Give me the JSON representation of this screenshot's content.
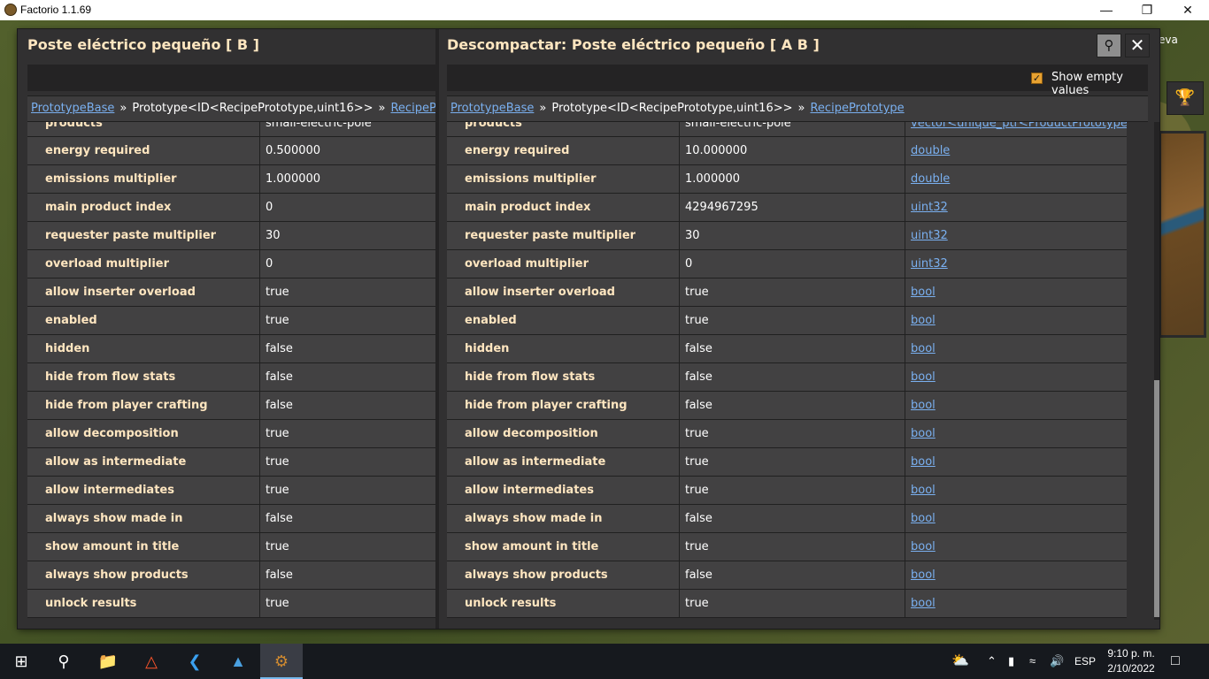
{
  "app": {
    "title": "Factorio 1.1.69"
  },
  "side": {
    "label": "eva"
  },
  "left": {
    "title": "Poste eléctrico pequeño [ B ]",
    "breadcrumb": [
      "PrototypeBase",
      "Prototype<ID<RecipePrototype,uint16>>",
      "RecipePrototype"
    ],
    "partial_value": "small-electric-pole",
    "rows": [
      {
        "name": "energy required",
        "value": "0.500000"
      },
      {
        "name": "emissions multiplier",
        "value": "1.000000"
      },
      {
        "name": "main product index",
        "value": "0"
      },
      {
        "name": "requester paste multiplier",
        "value": "30"
      },
      {
        "name": "overload multiplier",
        "value": "0"
      },
      {
        "name": "allow inserter overload",
        "value": "true"
      },
      {
        "name": "enabled",
        "value": "true"
      },
      {
        "name": "hidden",
        "value": "false"
      },
      {
        "name": "hide from flow stats",
        "value": "false"
      },
      {
        "name": "hide from player crafting",
        "value": "false"
      },
      {
        "name": "allow decomposition",
        "value": "true"
      },
      {
        "name": "allow as intermediate",
        "value": "true"
      },
      {
        "name": "allow intermediates",
        "value": "true"
      },
      {
        "name": "always show made in",
        "value": "false"
      },
      {
        "name": "show amount in title",
        "value": "true"
      },
      {
        "name": "always show products",
        "value": "false"
      },
      {
        "name": "unlock results",
        "value": "true"
      }
    ]
  },
  "right": {
    "title": "Descompactar: Poste eléctrico pequeño [ A B ]",
    "show_empty_values_label": "Show empty values",
    "show_empty_values_checked": true,
    "breadcrumb": [
      "PrototypeBase",
      "Prototype<ID<RecipePrototype,uint16>>",
      "RecipePrototype"
    ],
    "partial_value": "small-electric-pole",
    "partial_type": "vector<unique_ptr<ProductPrototype>>",
    "rows": [
      {
        "name": "energy required",
        "value": "10.000000",
        "type": "double"
      },
      {
        "name": "emissions multiplier",
        "value": "1.000000",
        "type": "double"
      },
      {
        "name": "main product index",
        "value": "4294967295",
        "type": "uint32"
      },
      {
        "name": "requester paste multiplier",
        "value": "30",
        "type": "uint32"
      },
      {
        "name": "overload multiplier",
        "value": "0",
        "type": "uint32"
      },
      {
        "name": "allow inserter overload",
        "value": "true",
        "type": "bool"
      },
      {
        "name": "enabled",
        "value": "true",
        "type": "bool"
      },
      {
        "name": "hidden",
        "value": "false",
        "type": "bool"
      },
      {
        "name": "hide from flow stats",
        "value": "false",
        "type": "bool"
      },
      {
        "name": "hide from player crafting",
        "value": "false",
        "type": "bool"
      },
      {
        "name": "allow decomposition",
        "value": "true",
        "type": "bool"
      },
      {
        "name": "allow as intermediate",
        "value": "true",
        "type": "bool"
      },
      {
        "name": "allow intermediates",
        "value": "true",
        "type": "bool"
      },
      {
        "name": "always show made in",
        "value": "false",
        "type": "bool"
      },
      {
        "name": "show amount in title",
        "value": "true",
        "type": "bool"
      },
      {
        "name": "always show products",
        "value": "false",
        "type": "bool"
      },
      {
        "name": "unlock results",
        "value": "true",
        "type": "bool"
      }
    ]
  },
  "taskbar": {
    "language": "ESP",
    "time": "9:10 p. m.",
    "date": "2/10/2022"
  },
  "colors": {
    "title_text": "#ffe6c0",
    "link": "#7ab0f0",
    "checkbox": "#e8a231",
    "panel_bg": "#313031",
    "row_bg": "#424142"
  }
}
